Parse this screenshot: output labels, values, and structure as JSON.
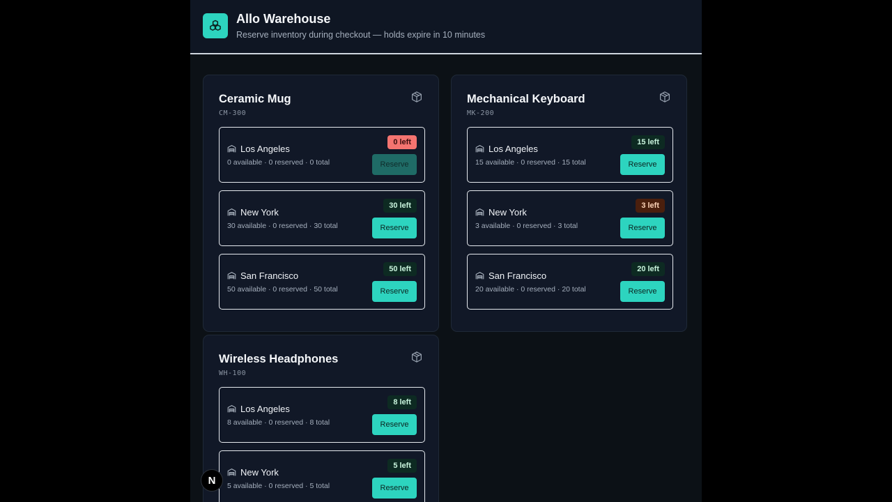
{
  "header": {
    "title": "Allo Warehouse",
    "subtitle": "Reserve inventory during checkout — holds expire in 10 minutes",
    "logo_icon": "boxes-icon"
  },
  "products": [
    {
      "name": "Ceramic Mug",
      "sku": "CM-300",
      "icon": "package-icon",
      "locations": [
        {
          "name": "Los Angeles",
          "stats": "0 available · 0 reserved · 0 total",
          "badge": "0 left",
          "status": "out",
          "reserve_label": "Reserve"
        },
        {
          "name": "New York",
          "stats": "30 available · 0 reserved · 30 total",
          "badge": "30 left",
          "status": "ok",
          "reserve_label": "Reserve"
        },
        {
          "name": "San Francisco",
          "stats": "50 available · 0 reserved · 50 total",
          "badge": "50 left",
          "status": "ok",
          "reserve_label": "Reserve"
        }
      ]
    },
    {
      "name": "Mechanical Keyboard",
      "sku": "MK-200",
      "icon": "package-icon",
      "locations": [
        {
          "name": "Los Angeles",
          "stats": "15 available · 0 reserved · 15 total",
          "badge": "15 left",
          "status": "ok",
          "reserve_label": "Reserve"
        },
        {
          "name": "New York",
          "stats": "3 available · 0 reserved · 3 total",
          "badge": "3 left",
          "status": "low",
          "reserve_label": "Reserve"
        },
        {
          "name": "San Francisco",
          "stats": "20 available · 0 reserved · 20 total",
          "badge": "20 left",
          "status": "ok",
          "reserve_label": "Reserve"
        }
      ]
    },
    {
      "name": "Wireless Headphones",
      "sku": "WH-100",
      "icon": "package-icon",
      "locations": [
        {
          "name": "Los Angeles",
          "stats": "8 available · 0 reserved · 8 total",
          "badge": "8 left",
          "status": "ok",
          "reserve_label": "Reserve"
        },
        {
          "name": "New York",
          "stats": "5 available · 0 reserved · 5 total",
          "badge": "5 left",
          "status": "ok",
          "reserve_label": "Reserve"
        }
      ]
    }
  ],
  "dev_badge": {
    "label": "N"
  },
  "colors": {
    "accent": "#2dd4bf",
    "background": "#0c1116",
    "card": "#111827"
  }
}
